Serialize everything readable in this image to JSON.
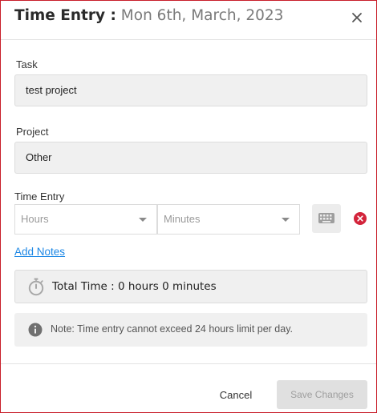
{
  "dialog": {
    "title_bold": "Time Entry :",
    "title_date": "Mon 6th, March, 2023"
  },
  "task": {
    "label": "Task",
    "value": "test project"
  },
  "project": {
    "label": "Project",
    "value": "Other"
  },
  "time_entry": {
    "label": "Time Entry",
    "hours_placeholder": "Hours",
    "minutes_placeholder": "Minutes"
  },
  "add_notes": "Add Notes",
  "total_time": "Total Time : 0 hours 0 minutes",
  "note": "Note: Time entry cannot exceed 24 hours limit per day.",
  "footer": {
    "cancel": "Cancel",
    "save": "Save Changes"
  },
  "icons": {
    "close": "close-icon",
    "keyboard": "keyboard-icon",
    "remove": "remove-circle-icon",
    "timer": "stopwatch-icon",
    "info": "info-icon"
  },
  "colors": {
    "link": "#1e88e5",
    "danger": "#d3243b",
    "frame": "#c81e2a"
  }
}
